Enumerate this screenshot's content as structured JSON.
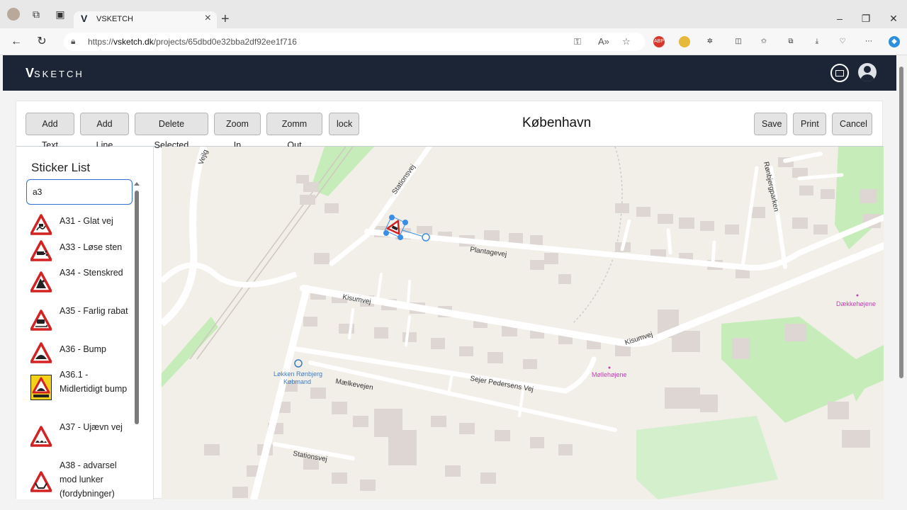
{
  "browser": {
    "tab_title": "VSKETCH",
    "tab_logo": "V",
    "url_prefix": "https://",
    "url_domain": "vsketch.dk",
    "url_path": "/projects/65dbd0e32bba2df92ee1f716",
    "ext_abp": "ABP"
  },
  "header": {
    "brand_v": "V",
    "brand_text": "SKETCH"
  },
  "toolbar": {
    "add_text": "Add Text",
    "add_line": "Add Line",
    "delete_selected": "Delete Selected",
    "zoom_in": "Zoom In",
    "zoom_out": "Zomm Out",
    "lock": "lock",
    "title": "København",
    "save": "Save",
    "print": "Print",
    "cancel": "Cancel"
  },
  "sidebar": {
    "title": "Sticker List",
    "search_value": "a3",
    "items": [
      {
        "label": "A31 - Glat vej",
        "sign": "triangle-red"
      },
      {
        "label": "A33 - Løse sten",
        "sign": "triangle-red"
      },
      {
        "label": "A34 - Stenskred",
        "sign": "triangle-red"
      },
      {
        "label": "A35 - Farlig rabat",
        "sign": "triangle-red"
      },
      {
        "label": "A36 - Bump",
        "sign": "triangle-red"
      },
      {
        "label": "A36.1 - Midlertidigt bump",
        "sign": "triangle-yellow-panel"
      },
      {
        "label": "A37 - Ujævn vej",
        "sign": "triangle-red"
      },
      {
        "label": "A38 - advarsel mod lunker (fordybninger)",
        "sign": "triangle-red"
      }
    ]
  },
  "map": {
    "street_labels": {
      "stationsvej_top": "Stationsvej",
      "vejlegade": "Vejlg",
      "plantagevej": "Plantagevej",
      "kisumvej_left": "Kisumvej",
      "kisumvej_right": "Kisumvej",
      "roenbjergparken": "Rønbjergparken",
      "maelkevejen": "Mælkevejen",
      "sejer": "Sejer Pedersens Vej",
      "stationsvej_bottom": "Stationsvej"
    },
    "poi": {
      "shop_line1": "Løkken Rønbjerg",
      "shop_line2": "Købmand",
      "moellehoejene": "Møllehøjene",
      "daekkehoejene": "Dækkehøjene"
    },
    "colors": {
      "land": "#f2efe9",
      "road": "#ffffff",
      "building": "#ddd6d2",
      "green": "#c6ecb9",
      "park": "#d4efcc",
      "selection": "#3a8ee6",
      "poi_text": "#c13fb5",
      "shop_text": "#3b7dc4"
    }
  }
}
